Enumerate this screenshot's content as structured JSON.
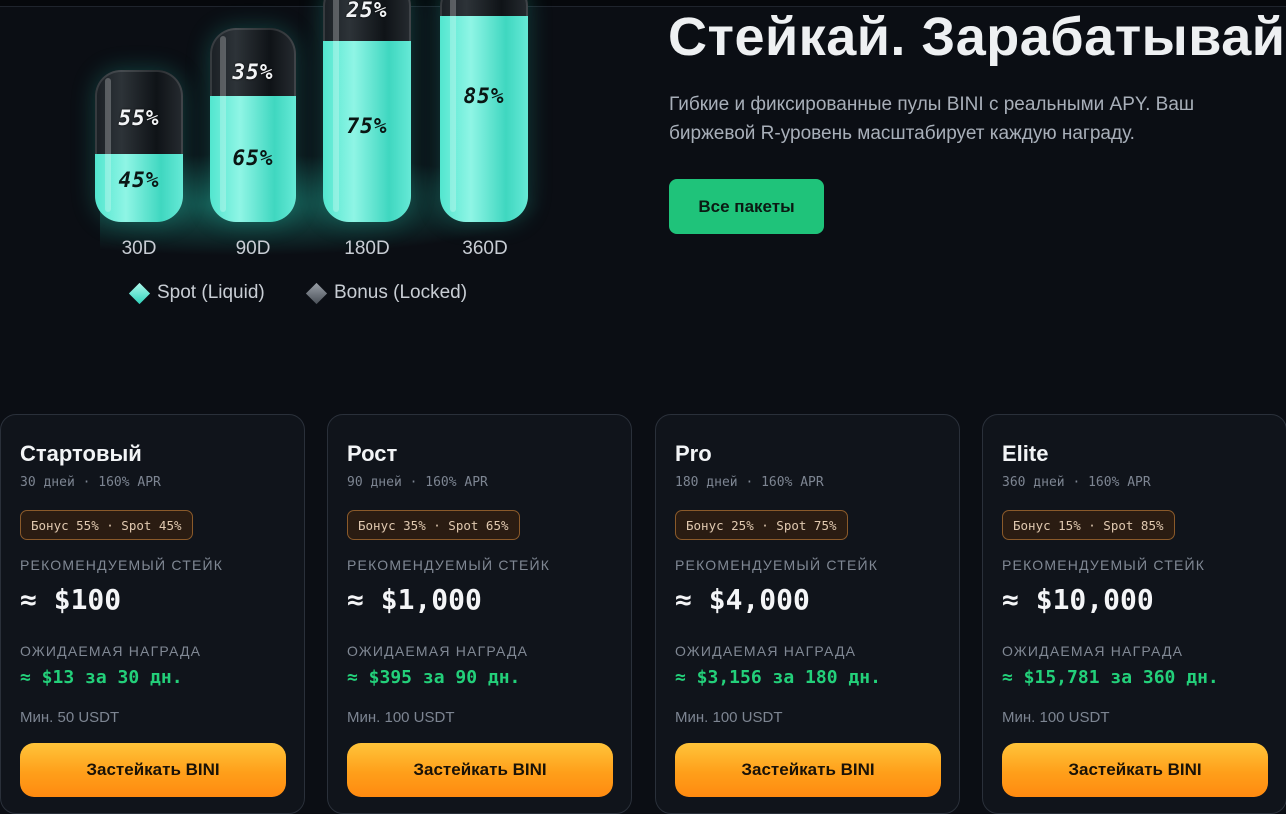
{
  "hero": {
    "title": "Стейкай. Зарабатывай.",
    "subtitle": "Гибкие и фиксированные пулы BINI с реальными APY. Ваш биржевой R-уровень масштабирует каждую награду.",
    "cta_label": "Все пакеты",
    "colors": {
      "accent_green": "#1fc37a",
      "liquid_teal": "#52e6cf"
    }
  },
  "tubes": [
    {
      "label": "30D",
      "top_pct": "55%",
      "bottom_pct": "45%",
      "fill_fraction": 0.45
    },
    {
      "label": "90D",
      "top_pct": "35%",
      "bottom_pct": "65%",
      "fill_fraction": 0.65
    },
    {
      "label": "180D",
      "top_pct": "25%",
      "bottom_pct": "75%",
      "fill_fraction": 0.75
    },
    {
      "label": "360D",
      "top_pct": "",
      "bottom_pct": "85%",
      "fill_fraction": 0.85
    }
  ],
  "legend": {
    "spot": "Spot (Liquid)",
    "bonus": "Bonus (Locked)"
  },
  "cards": [
    {
      "name": "Стартовый",
      "meta": "30 дней · 160% APR",
      "badge": "Бонус 55% · Spot 45%",
      "stake_label": "РЕКОМЕНДУЕМЫЙ СТЕЙК",
      "stake": "≈ $100",
      "reward_label": "ОЖИДАЕМАЯ НАГРАДА",
      "reward": "≈ $13 за 30 дн.",
      "min": "Мин. 50 USDT",
      "button": "Застейкать BINI"
    },
    {
      "name": "Рост",
      "meta": "90 дней · 160% APR",
      "badge": "Бонус 35% · Spot 65%",
      "stake_label": "РЕКОМЕНДУЕМЫЙ СТЕЙК",
      "stake": "≈ $1,000",
      "reward_label": "ОЖИДАЕМАЯ НАГРАДА",
      "reward": "≈ $395 за 90 дн.",
      "min": "Мин. 100 USDT",
      "button": "Застейкать BINI"
    },
    {
      "name": "Pro",
      "meta": "180 дней · 160% APR",
      "badge": "Бонус 25% · Spot 75%",
      "stake_label": "РЕКОМЕНДУЕМЫЙ СТЕЙК",
      "stake": "≈ $4,000",
      "reward_label": "ОЖИДАЕМАЯ НАГРАДА",
      "reward": "≈ $3,156 за 180 дн.",
      "min": "Мин. 100 USDT",
      "button": "Застейкать BINI"
    },
    {
      "name": "Elite",
      "meta": "360 дней · 160% APR",
      "badge": "Бонус 15% · Spot 85%",
      "stake_label": "РЕКОМЕНДУЕМЫЙ СТЕЙК",
      "stake": "≈ $10,000",
      "reward_label": "ОЖИДАЕМАЯ НАГРАДА",
      "reward": "≈ $15,781 за 360 дн.",
      "min": "Мин. 100 USDT",
      "button": "Застейкать BINI"
    }
  ]
}
